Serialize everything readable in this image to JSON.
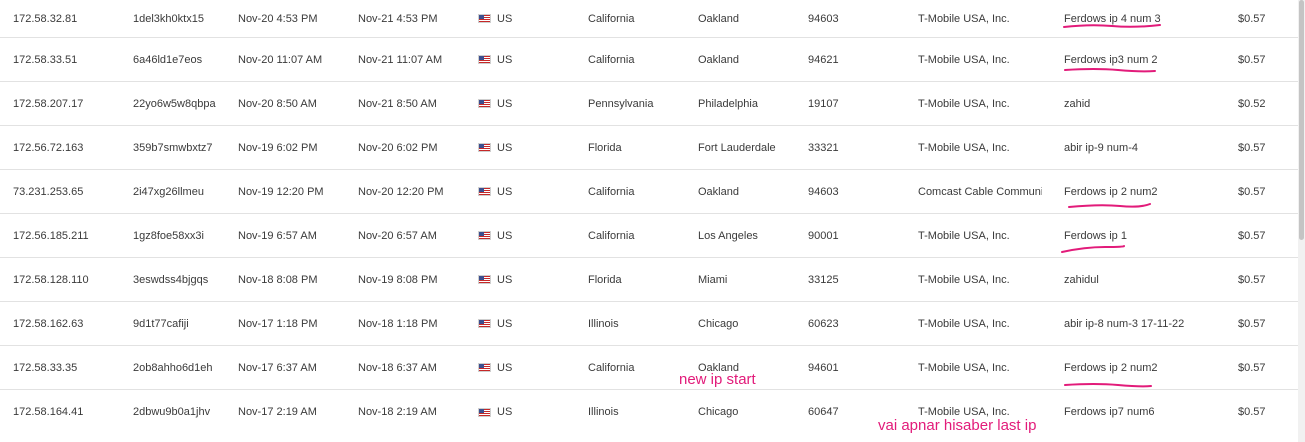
{
  "rows": [
    {
      "ip": "172.58.32.81",
      "id": "1del3kh0ktx15",
      "start": "Nov-20 4:53 PM",
      "end": "Nov-21 4:53 PM",
      "country": "US",
      "state": "California",
      "city": "Oakland",
      "zip": "94603",
      "isp": "T-Mobile USA, Inc.",
      "note": "Ferdows ip 4 num 3",
      "price": "$0.57"
    },
    {
      "ip": "172.58.33.51",
      "id": "6a46ld1e7eos",
      "start": "Nov-20 11:07 AM",
      "end": "Nov-21 11:07 AM",
      "country": "US",
      "state": "California",
      "city": "Oakland",
      "zip": "94621",
      "isp": "T-Mobile USA, Inc.",
      "note": "Ferdows ip3 num 2",
      "price": "$0.57"
    },
    {
      "ip": "172.58.207.17",
      "id": "22yo6w5w8qbpa",
      "start": "Nov-20 8:50 AM",
      "end": "Nov-21 8:50 AM",
      "country": "US",
      "state": "Pennsylvania",
      "city": "Philadelphia",
      "zip": "19107",
      "isp": "T-Mobile USA, Inc.",
      "note": "zahid",
      "price": "$0.52"
    },
    {
      "ip": "172.56.72.163",
      "id": "359b7smwbxtz7",
      "start": "Nov-19 6:02 PM",
      "end": "Nov-20 6:02 PM",
      "country": "US",
      "state": "Florida",
      "city": "Fort Lauderdale",
      "zip": "33321",
      "isp": "T-Mobile USA, Inc.",
      "note": "abir ip-9 num-4",
      "price": "$0.57"
    },
    {
      "ip": "73.231.253.65",
      "id": "2i47xg26llmeu",
      "start": "Nov-19 12:20 PM",
      "end": "Nov-20 12:20 PM",
      "country": "US",
      "state": "California",
      "city": "Oakland",
      "zip": "94603",
      "isp": "Comcast Cable Communi...",
      "note": "Ferdows ip 2 num2",
      "price": "$0.57"
    },
    {
      "ip": "172.56.185.211",
      "id": "1gz8foe58xx3i",
      "start": "Nov-19 6:57 AM",
      "end": "Nov-20 6:57 AM",
      "country": "US",
      "state": "California",
      "city": "Los Angeles",
      "zip": "90001",
      "isp": "T-Mobile USA, Inc.",
      "note": "Ferdows ip 1",
      "price": "$0.57"
    },
    {
      "ip": "172.58.128.110",
      "id": "3eswdss4bjgqs",
      "start": "Nov-18 8:08 PM",
      "end": "Nov-19 8:08 PM",
      "country": "US",
      "state": "Florida",
      "city": "Miami",
      "zip": "33125",
      "isp": "T-Mobile USA, Inc.",
      "note": "zahidul",
      "price": "$0.57"
    },
    {
      "ip": "172.58.162.63",
      "id": "9d1t77cafiji",
      "start": "Nov-17 1:18 PM",
      "end": "Nov-18 1:18 PM",
      "country": "US",
      "state": "Illinois",
      "city": "Chicago",
      "zip": "60623",
      "isp": "T-Mobile USA, Inc.",
      "note": "abir ip-8 num-3 17-11-22",
      "price": "$0.57"
    },
    {
      "ip": "172.58.33.35",
      "id": "2ob8ahho6d1eh",
      "start": "Nov-17 6:37 AM",
      "end": "Nov-18 6:37 AM",
      "country": "US",
      "state": "California",
      "city": "Oakland",
      "zip": "94601",
      "isp": "T-Mobile USA, Inc.",
      "note": "Ferdows ip 2 num2",
      "price": "$0.57"
    },
    {
      "ip": "172.58.164.41",
      "id": "2dbwu9b0a1jhv",
      "start": "Nov-17 2:19 AM",
      "end": "Nov-18 2:19 AM",
      "country": "US",
      "state": "Illinois",
      "city": "Chicago",
      "zip": "60647",
      "isp": "T-Mobile USA, Inc.",
      "note": "Ferdows ip7 num6",
      "price": "$0.57"
    }
  ],
  "annotations": {
    "new_ip_start": "new ip start",
    "last_ip": "vai apnar hisaber last ip",
    "color": "#e21b7a"
  }
}
